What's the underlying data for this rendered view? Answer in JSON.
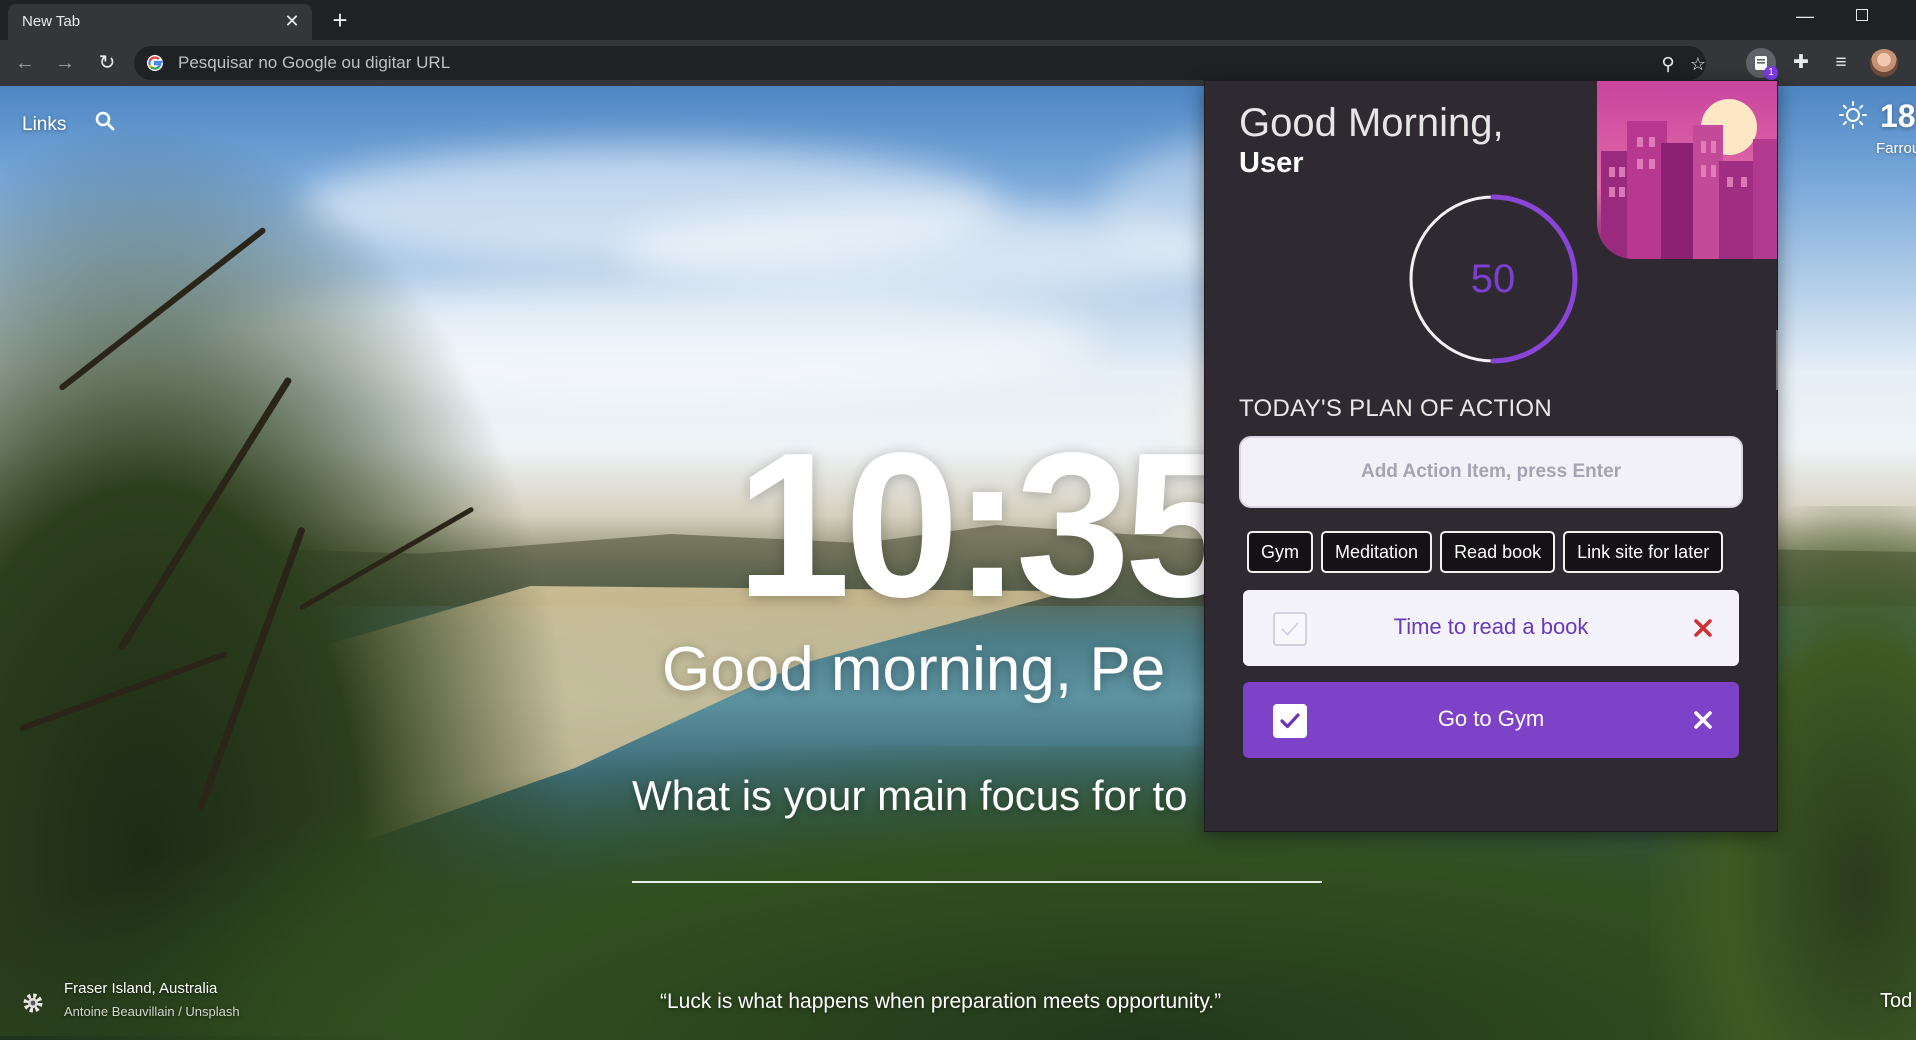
{
  "browser": {
    "tab_title": "New Tab",
    "tab_close": "✕",
    "new_tab": "+",
    "minimize": "—",
    "omnibox_placeholder": "Pesquisar no Google ou digitar URL",
    "extension_badge": "1"
  },
  "page": {
    "links_label": "Links",
    "weather_temp": "18",
    "weather_location": "Farroupilh",
    "clock": "10:35",
    "greeting": "Good morning, Pe",
    "focus_question": "What is your main focus for to",
    "photo_location": "Fraser Island, Australia",
    "photo_credit": "Antoine Beauvillain / Unsplash",
    "quote": "“Luck is what happens when preparation meets opportunity.”",
    "todo_corner": "Tod"
  },
  "popup": {
    "greeting": "Good Morning,",
    "user": "User",
    "timer_value": "50",
    "timer_progress": 0.5,
    "plan_title": "TODAY'S PLAN OF ACTION",
    "input_placeholder": "Add Action Item, press Enter",
    "chips": [
      "Gym",
      "Meditation",
      "Read book",
      "Link site for later"
    ],
    "tasks": [
      {
        "text": "Time to read a book",
        "done": false
      },
      {
        "text": "Go to Gym",
        "done": true
      }
    ]
  },
  "colors": {
    "accent_purple": "#7d42c8",
    "popup_bg": "#2f2a32",
    "delete_red": "#d32f2f"
  }
}
